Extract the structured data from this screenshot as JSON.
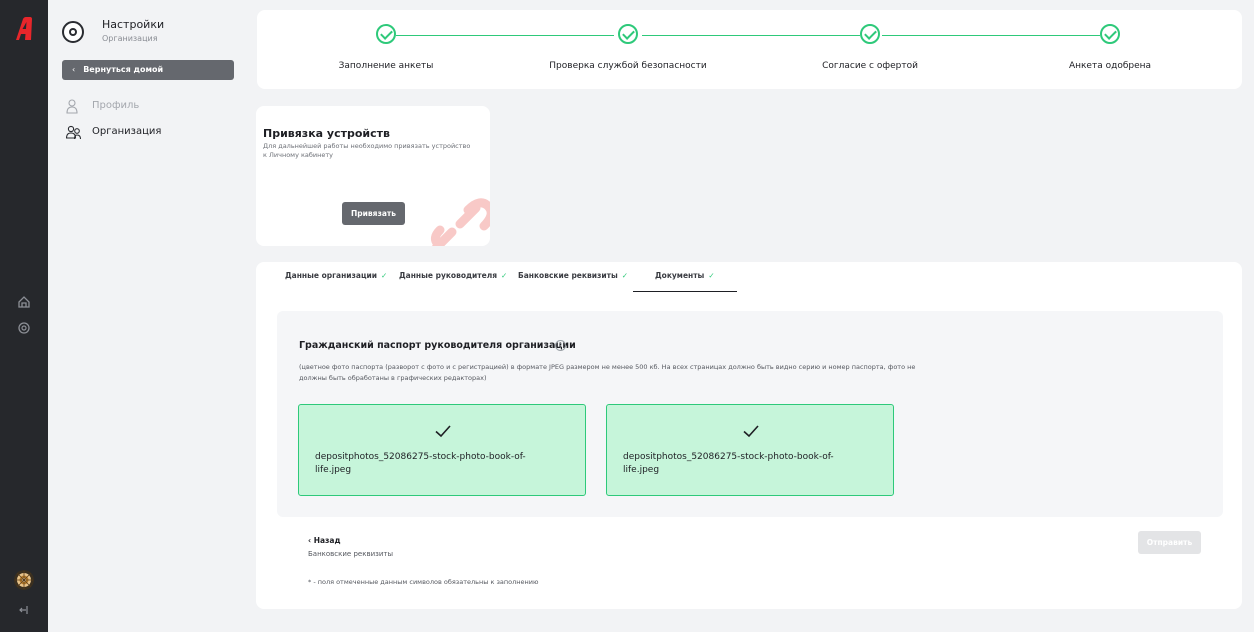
{
  "app": {
    "logo_icon": "brand-logo-letter-a",
    "brand_color": "#e8262b"
  },
  "rail": {
    "icons": [
      "home-icon",
      "settings-icon",
      "user-avatar",
      "logout-icon"
    ]
  },
  "sidebar": {
    "title": "Настройки",
    "subtitle": "Организация",
    "back_label": "Вернуться домой",
    "items": [
      {
        "label": "Профиль",
        "icon": "user-icon",
        "active": false
      },
      {
        "label": "Организация",
        "icon": "users-icon",
        "active": true
      }
    ]
  },
  "steps": {
    "items": [
      {
        "label": "Заполнение анкеты",
        "done": true
      },
      {
        "label": "Проверка службой безопасности",
        "done": true
      },
      {
        "label": "Согласие с офертой",
        "done": true
      },
      {
        "label": "Анкета одобрена",
        "done": true
      }
    ],
    "accent": "#2ec97a"
  },
  "device_binding": {
    "title": "Привязка устройств",
    "description": "Для дальнейшей работы необходимо привязать устройство к Личному кабинету",
    "button_label": "Привязать"
  },
  "tabs": [
    {
      "label": "Данные организации",
      "done": true
    },
    {
      "label": "Данные руководителя",
      "done": true
    },
    {
      "label": "Банковские реквизиты",
      "done": true
    },
    {
      "label": "Документы",
      "done": true,
      "active": true
    }
  ],
  "passport": {
    "title": "Гражданский паспорт руководителя организации",
    "help_icon": "?",
    "description": "(цветное фото паспорта (разворот с фото и с регистрацией) в формате JPEG размером не менее 500 кб. На всех страницах должно быть видно серию и номер паспорта, фото не должны быть обработаны в графических редакторах)",
    "files": [
      {
        "name": "depositphotos_52086275-stock-photo-book-of-life.jpeg",
        "status": "uploaded"
      },
      {
        "name": "depositphotos_52086275-stock-photo-book-of-life.jpeg",
        "status": "uploaded"
      }
    ]
  },
  "footer": {
    "back_label": "‹ Назад",
    "back_sub": "Банковские реквизиты",
    "submit_label": "Отправить",
    "note": "* - поля отмеченные данным символов обязательны к заполнению"
  }
}
